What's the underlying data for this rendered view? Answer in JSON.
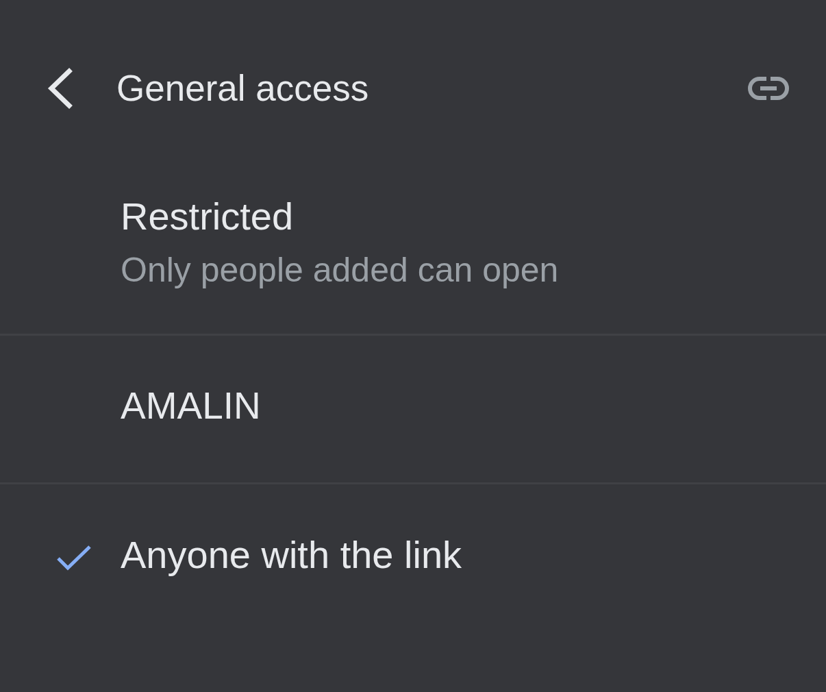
{
  "header": {
    "title": "General access"
  },
  "options": [
    {
      "title": "Restricted",
      "subtitle": "Only people added can open",
      "selected": false
    },
    {
      "title": "AMALIN",
      "selected": false
    },
    {
      "title": "Anyone with the link",
      "selected": true
    }
  ]
}
